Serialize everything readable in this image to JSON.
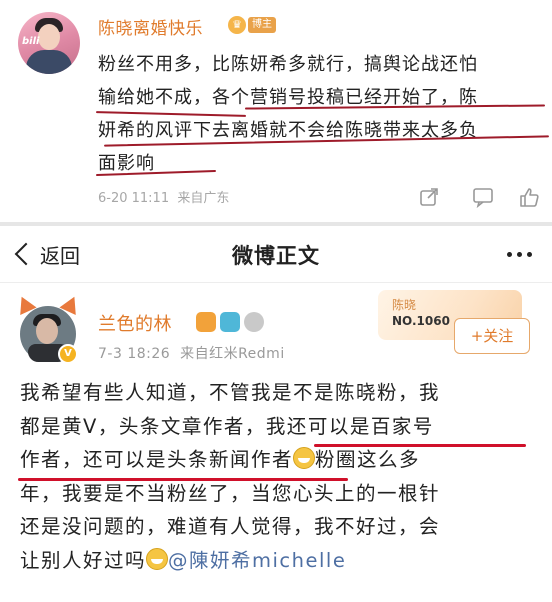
{
  "top_post": {
    "avatar_logo_text": "bili",
    "username": "陈晓离婚快乐",
    "badge_label": "博主",
    "text": "粉丝不用多，比陈妍希多就行，搞舆论战还怕输给她不成，各个营销号投稿已经开始了，陈妍希的风评下去离婚就不会给陈晓带来太多负面影响",
    "lines": [
      "粉丝不用多，比陈妍希多就行，搞舆论战还怕",
      "输给她不成，各个营销号投稿已经开始了，陈",
      "妍希的风评下去离婚就不会给陈晓带来太多负",
      "面影响"
    ],
    "timestamp": "6-20 11:11",
    "location": "来自广东",
    "icons": [
      "share-icon",
      "comment-icon",
      "like-icon"
    ]
  },
  "detail_page": {
    "back_label": "返回",
    "title": "微博正文",
    "more_icon": "more-dots-icon",
    "username": "兰色的林",
    "time": "7-3 18:26",
    "source": "来自红米Redmi",
    "fan_badge": {
      "name": "陈晓",
      "number": "NO.1060"
    },
    "follow_label": "+关注",
    "lines": [
      "我希望有些人知道，不管我是不是陈晓粉，我",
      "都是黄V，头条文章作者，我还可以是百家号",
      "作者，还可以是头条新闻作者",
      "粉圈这么多",
      "年，我要是不当粉丝了，当您心头上的一根针",
      "还是没问题的，难道有人觉得，我不好过，会",
      "让别人好过吗",
      "@陳妍希michelle"
    ]
  },
  "colors": {
    "username": "#e07b2c",
    "underline_top": "#9e1b2a",
    "underline_bottom": "#d0102a",
    "mention": "#4e6fa3"
  }
}
